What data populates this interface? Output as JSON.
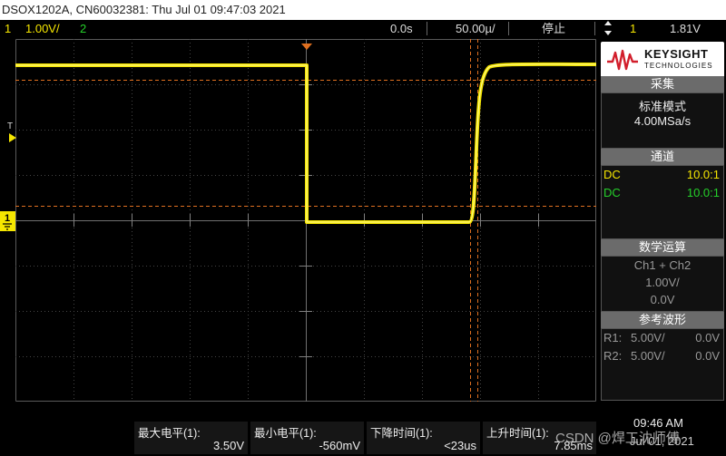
{
  "title_bar": {
    "text": "DSOX1202A, CN60032381: Thu Jul 01 09:47:03 2021"
  },
  "status": {
    "ch1_num": "1",
    "ch1_scale": "1.00V/",
    "ch2_num": "2",
    "time_delay": "0.0s",
    "time_scale": "50.00µ/",
    "run_state": "停止",
    "trigger_icon": "trigger-edge-icon",
    "trigger_source": "1",
    "trigger_level": "1.81V"
  },
  "markers": {
    "trigger_side": "T",
    "channel1_ground": "1"
  },
  "sidebar": {
    "brand_name": "KEYSIGHT",
    "brand_sub": "TECHNOLOGIES",
    "acquire_header": "采集",
    "acquire_mode": "标准模式",
    "acquire_rate": "4.00MSa/s",
    "channels_header": "通道",
    "channels": [
      {
        "coupling": "DC",
        "probe": "10.0:1",
        "color": "#f5e600"
      },
      {
        "coupling": "DC",
        "probe": "10.0:1",
        "color": "#25d02a"
      }
    ],
    "math_header": "数学运算",
    "math_func": "Ch1 + Ch2",
    "math_scale": "1.00V/",
    "math_offset": "0.0V",
    "ref_header": "参考波形",
    "refs": [
      {
        "name": "R1:",
        "scale": "5.00V/",
        "offset": "0.0V"
      },
      {
        "name": "R2:",
        "scale": "5.00V/",
        "offset": "0.0V"
      }
    ]
  },
  "measurements": [
    {
      "label": "最大电平(1):",
      "value": "3.50V"
    },
    {
      "label": "最小电平(1):",
      "value": "-560mV"
    },
    {
      "label": "下降时间(1):",
      "value": "<23us"
    },
    {
      "label": "上升时间(1):",
      "value": "7.85ms"
    }
  ],
  "clock": {
    "time": "09:46 AM",
    "date": "Jul 01, 2021"
  },
  "watermark": "CSDN @焊工沈师傅",
  "colors": {
    "ch1": "#f5e600",
    "ch2": "#25d02a",
    "cursor": "#e07020",
    "grid": "#5a5a5a"
  }
}
